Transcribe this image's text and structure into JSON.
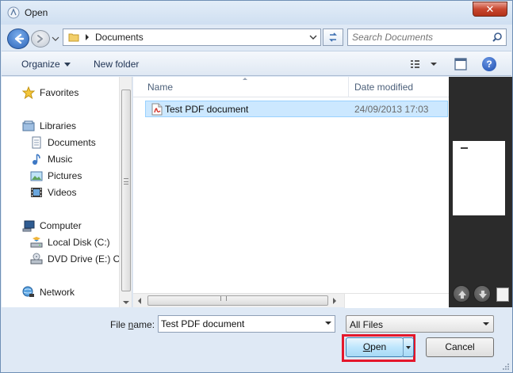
{
  "window": {
    "title": "Open",
    "close_glyph": "✕"
  },
  "address_bar": {
    "breadcrumb": "Documents",
    "folder_icon": "folder-icon"
  },
  "search": {
    "placeholder": "Search Documents"
  },
  "toolbar": {
    "organize_label": "Organize",
    "new_folder_label": "New folder",
    "help_glyph": "?"
  },
  "navigation": {
    "favorites": "Favorites",
    "libraries": "Libraries",
    "documents": "Documents",
    "music": "Music",
    "pictures": "Pictures",
    "videos": "Videos",
    "computer": "Computer",
    "local_disk": "Local Disk (C:)",
    "dvd_drive": "DVD Drive (E:) OF",
    "network": "Network"
  },
  "file_list": {
    "columns": {
      "name": "Name",
      "date_modified": "Date modified"
    },
    "files": [
      {
        "name": "Test PDF document",
        "date_modified": "24/09/2013 17:03",
        "type_icon": "pdf-icon",
        "selected": true
      }
    ]
  },
  "footer": {
    "file_name_label_pre": "File ",
    "file_name_label_key": "n",
    "file_name_label_post": "ame:",
    "file_name_value": "Test PDF document",
    "file_type_value": "All Files",
    "open_label_key": "O",
    "open_label_post": "pen",
    "cancel_label": "Cancel"
  },
  "colors": {
    "highlight_border": "#e4172b",
    "selection": "#cce8ff",
    "preview_bg": "#2b2b2b",
    "chrome": "#dfe9f5"
  }
}
